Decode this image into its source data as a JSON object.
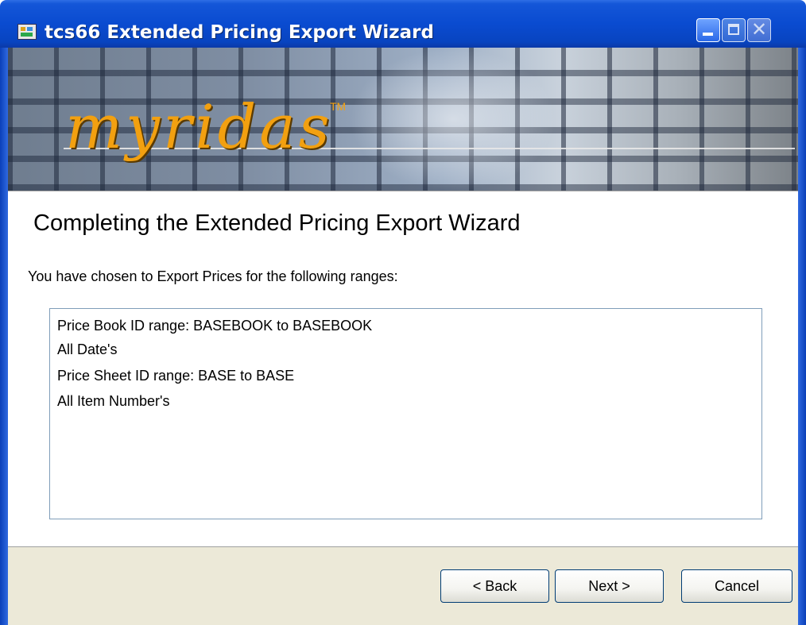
{
  "window": {
    "title": "tcs66 Extended Pricing Export Wizard",
    "icon": "app-icon",
    "controls": {
      "minimize": "minimize-icon",
      "maximize": "maximize-icon",
      "close": "close-icon"
    }
  },
  "banner": {
    "logo_text": "myridas",
    "trademark": "TM"
  },
  "main": {
    "heading": "Completing the Extended Pricing Export Wizard",
    "intro": "You have chosen to Export Prices for the following ranges:",
    "summary_lines": [
      "Price Book ID range: BASEBOOK to BASEBOOK",
      "All Date's",
      "Price Sheet ID range: BASE to BASE",
      "All Item Number's"
    ]
  },
  "footer": {
    "back_label": "< Back",
    "next_label": "Next >",
    "cancel_label": "Cancel"
  },
  "colors": {
    "titlebar": "#0a4bd0",
    "logo": "#f2a010",
    "footer_bg": "#ece9d8",
    "listbox_border": "#7f9db9"
  }
}
